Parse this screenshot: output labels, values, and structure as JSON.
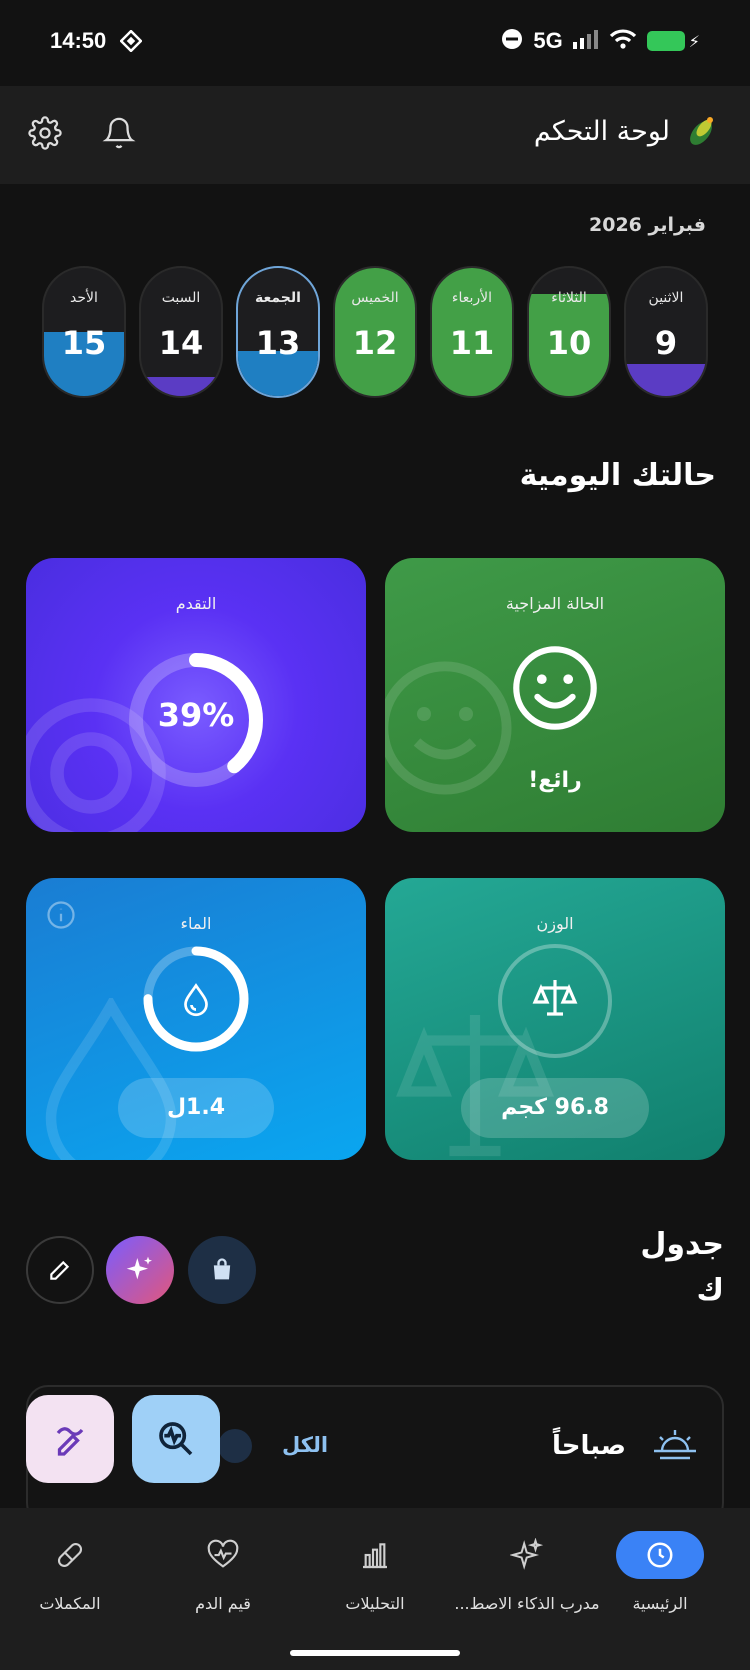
{
  "status_bar": {
    "time": "14:50",
    "network": "5G"
  },
  "header": {
    "title": "لوحة التحكم"
  },
  "calendar": {
    "month": "فبراير 2026",
    "days": [
      {
        "name": "الاثنين",
        "num": "9",
        "fill": 0.25,
        "color": "#5b3cc4"
      },
      {
        "name": "الثلاثاء",
        "num": "10",
        "fill": 0.8,
        "color": "#43a047"
      },
      {
        "name": "الأربعاء",
        "num": "11",
        "fill": 1.0,
        "color": "#43a047"
      },
      {
        "name": "الخميس",
        "num": "12",
        "fill": 1.0,
        "color": "#43a047"
      },
      {
        "name": "الجمعة",
        "num": "13",
        "fill": 0.35,
        "color": "#1f7fc2"
      },
      {
        "name": "السبت",
        "num": "14",
        "fill": 0.15,
        "color": "#5b3cc4"
      },
      {
        "name": "الأحد",
        "num": "15",
        "fill": 0.5,
        "color": "#1f7fc2"
      }
    ]
  },
  "daily": {
    "title": "حالتك اليومية",
    "mood": {
      "label": "الحالة المزاجية",
      "value": "رائع!"
    },
    "progress": {
      "label": "التقدم",
      "value": "39%",
      "percent": 39
    },
    "weight": {
      "label": "الوزن",
      "value": "96.8 كجم"
    },
    "water": {
      "label": "الماء",
      "value": "1.4ل",
      "percent": 75
    }
  },
  "schedule": {
    "title_line1": "جدول",
    "title_line2": "ك",
    "morning": "صباحاً",
    "all": "الكل"
  },
  "nav": {
    "items": [
      {
        "label": "الرئيسية",
        "icon": "clock-icon"
      },
      {
        "label": "مدرب الذكاء الاصط...",
        "icon": "sparkle-icon"
      },
      {
        "label": "التحليلات",
        "icon": "bar-chart-icon"
      },
      {
        "label": "قيم الدم",
        "icon": "heart-pulse-icon"
      },
      {
        "label": "المكملات",
        "icon": "pill-icon"
      }
    ]
  }
}
